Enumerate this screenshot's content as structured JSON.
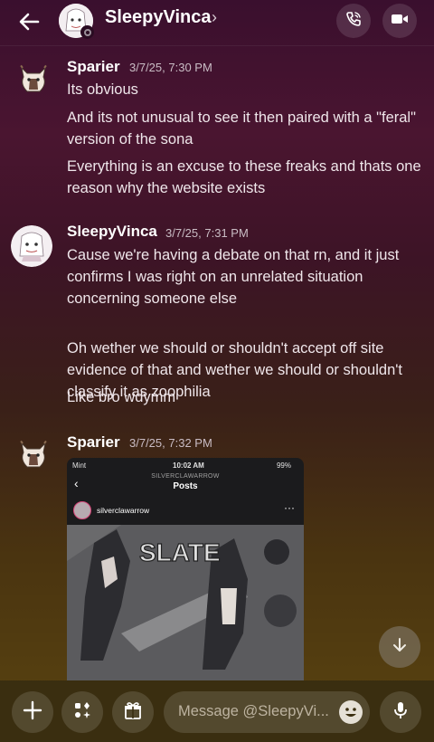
{
  "header": {
    "username": "SleepyVinca",
    "chevron": "›",
    "icons": {
      "back": "arrow-left-icon",
      "call": "phone-call-icon",
      "video": "video-camera-icon"
    }
  },
  "messages": [
    {
      "author": "Sparier",
      "timestamp": "3/7/25, 7:30 PM",
      "lines": [
        "Its obvious",
        "And its not unusual to see it then paired with a \"feral\" version of the sona",
        "Everything is an excuse to these freaks and thats one reason why the website exists"
      ]
    },
    {
      "author": "SleepyVinca",
      "timestamp": "3/7/25, 7:31 PM",
      "lines": [
        "Cause we're having a debate on that rn, and it just confirms I was right on an unrelated situation concerning someone else",
        "Oh wether we should or shouldn't accept off site evidence of that and wether we should or shouldn't classify it as zoophilia",
        "Like bro wdymm"
      ]
    },
    {
      "author": "Sparier",
      "timestamp": "3/7/25, 7:32 PM",
      "attachment": {
        "carrier": "Mint",
        "clock": "10:02 AM",
        "battery": "99%",
        "account_caps": "SILVERCLAWARROW",
        "screen_title": "Posts",
        "post_username": "silverclawarrow",
        "more": "···",
        "art_title": "SLATE"
      }
    }
  ],
  "composer": {
    "placeholder": "Message @SleepyVi...",
    "icons": {
      "add": "plus-icon",
      "apps": "apps-icon",
      "gift": "gift-icon",
      "emoji": "emoji-icon",
      "mic": "microphone-icon"
    }
  }
}
